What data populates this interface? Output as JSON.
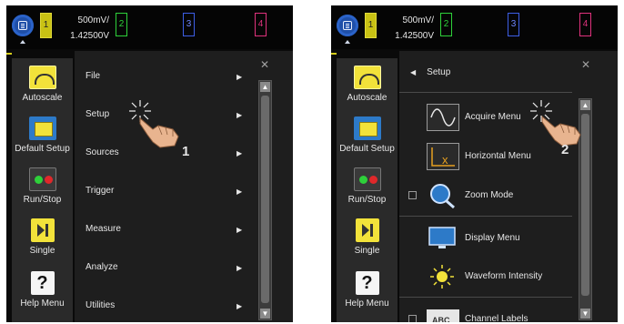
{
  "panels": [
    {
      "menu_icon": "menu-icon",
      "channel_1": "1",
      "scale_line_1": "500mV/",
      "scale_line_2": "1.42500V",
      "channel_2": "2",
      "channel_3": "3",
      "channel_4": "4",
      "sidebar": [
        "Autoscale",
        "Default Setup",
        "Run/Stop",
        "Single",
        "Help Menu"
      ],
      "menu_items": [
        "File",
        "Setup",
        "Sources",
        "Trigger",
        "Measure",
        "Analyze",
        "Utilities"
      ],
      "step": "1"
    },
    {
      "menu_icon": "menu-icon",
      "channel_1": "1",
      "scale_line_1": "500mV/",
      "scale_line_2": "1.42500V",
      "channel_2": "2",
      "channel_3": "3",
      "channel_4": "4",
      "sidebar": [
        "Autoscale",
        "Default Setup",
        "Run/Stop",
        "Single",
        "Help Menu"
      ],
      "submenu_title": "Setup",
      "submenu_items": [
        "Acquire Menu",
        "Horizontal Menu",
        "Zoom Mode",
        "Display Menu",
        "Waveform Intensity",
        "Channel Labels"
      ],
      "step": "2"
    }
  ],
  "icons": {
    "close": "close-icon",
    "scroll_up": "arrow-up-icon",
    "scroll_down": "arrow-down-icon",
    "arrow": "triangle-right-icon"
  },
  "colors": {
    "channel_1": "#c9c214",
    "channel_2": "#2ed13a",
    "channel_3": "#3d5fe6",
    "channel_4": "#e0327d",
    "menu_button": "#1f4fa8"
  }
}
